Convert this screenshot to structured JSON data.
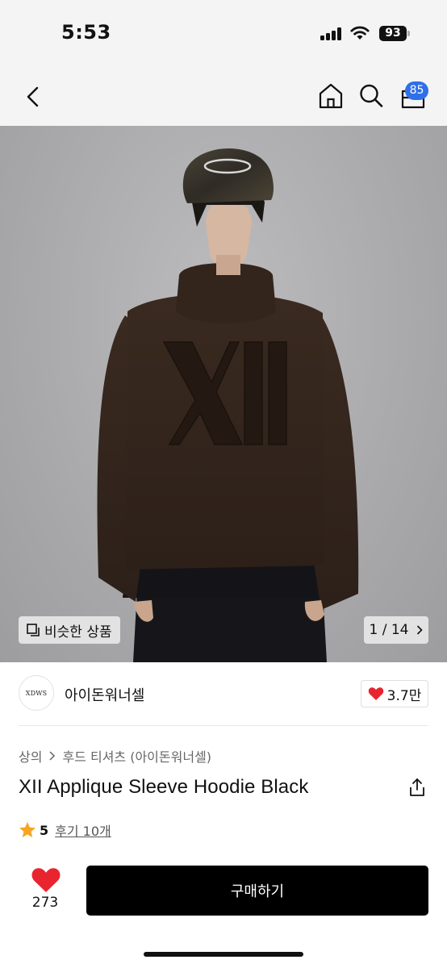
{
  "status_bar": {
    "time": "5:53",
    "battery": "93"
  },
  "nav": {
    "cart_badge": "85",
    "icons": [
      "back-icon",
      "home-icon",
      "search-icon",
      "cart-icon"
    ]
  },
  "image": {
    "similar_label": "비슷한 상품",
    "counter": "1 / 14"
  },
  "shop": {
    "logo_text": "XDWS",
    "name": "아이돈워너셀",
    "likes": "3.7만"
  },
  "breadcrumb": {
    "category": "상의",
    "subcategory": "후드 티셔츠 (아이돈워너셀)"
  },
  "product": {
    "title": "XII Applique Sleeve Hoodie Black"
  },
  "rating": {
    "score": "5",
    "reviews": "후기 10개"
  },
  "bottom": {
    "like_count": "273",
    "buy_label": "구매하기"
  },
  "colors": {
    "accent_blue": "#2f6fe8",
    "heart_red": "#e8252f",
    "star": "#f5a623",
    "button_black": "#000000"
  }
}
